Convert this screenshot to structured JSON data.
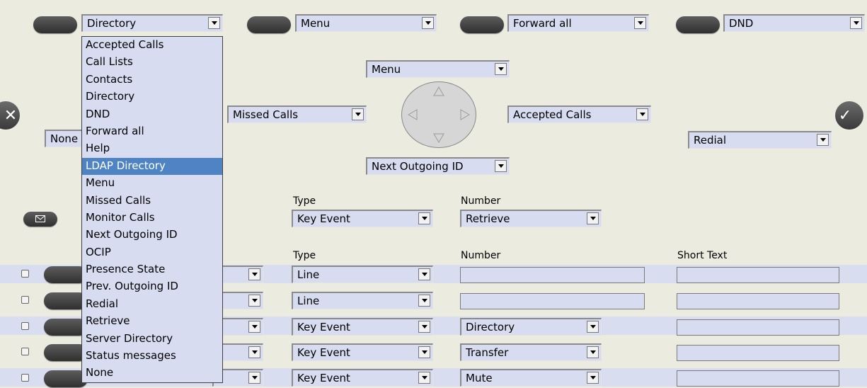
{
  "top_keys": [
    {
      "value": "Directory"
    },
    {
      "value": "Menu"
    },
    {
      "value": "Forward all"
    },
    {
      "value": "DND"
    }
  ],
  "dropdown": {
    "options": [
      "Accepted Calls",
      "Call Lists",
      "Contacts",
      "Directory",
      "DND",
      "Forward all",
      "Help",
      "LDAP Directory",
      "Menu",
      "Missed Calls",
      "Monitor Calls",
      "Next Outgoing ID",
      "OCIP",
      "Presence State",
      "Prev. Outgoing ID",
      "Redial",
      "Retrieve",
      "Server Directory",
      "Status messages",
      "None"
    ],
    "highlighted": "LDAP Directory"
  },
  "nav": {
    "up": "Menu",
    "left": "Missed Calls",
    "right": "Accepted Calls",
    "down": "Next Outgoing ID",
    "cancel_value": "None",
    "ok_value": "Redial"
  },
  "message_key": {
    "type_label": "Type",
    "type_value": "Key Event",
    "number_label": "Number",
    "number_value": "Retrieve"
  },
  "table": {
    "headers": {
      "type": "Type",
      "number": "Number",
      "short_text": "Short Text"
    },
    "rows": [
      {
        "type": "Line",
        "number": "",
        "short_text": ""
      },
      {
        "type": "Line",
        "number": "",
        "short_text": ""
      },
      {
        "type": "Key Event",
        "number": "Directory",
        "short_text": ""
      },
      {
        "type": "Key Event",
        "number": "Transfer",
        "short_text": ""
      },
      {
        "type": "Key Event",
        "number": "Mute",
        "short_text": ""
      }
    ]
  },
  "icons": {
    "cancel": "x-icon",
    "ok": "check-icon",
    "message": "envelope-icon"
  },
  "colors": {
    "background": "#ecebe0",
    "field": "#d7dcf0",
    "highlight": "#4f84c4",
    "button": "#4a4a4a"
  }
}
